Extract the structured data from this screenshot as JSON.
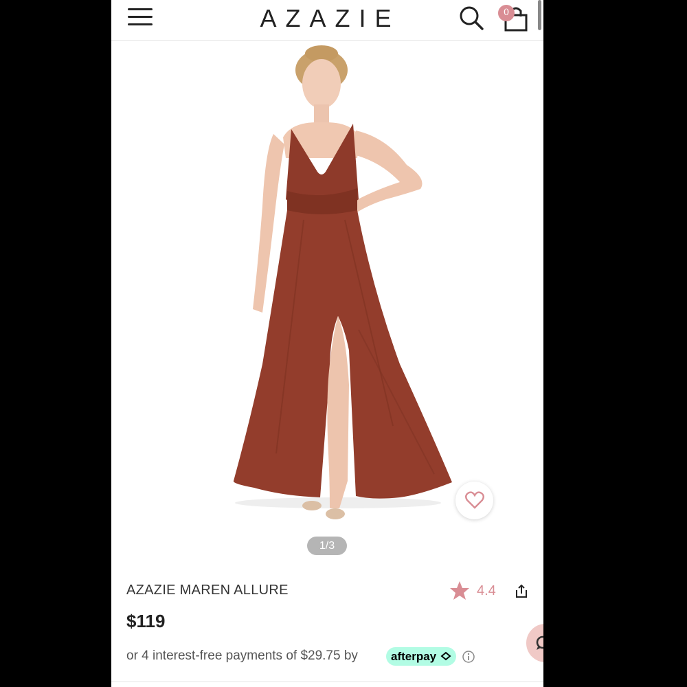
{
  "header": {
    "logo": "AZAZIE",
    "cart_count": "0"
  },
  "gallery": {
    "counter": "1/3"
  },
  "product": {
    "name": "AZAZIE MAREN ALLURE",
    "rating": "4.4",
    "price": "$119",
    "installment_text": "or 4 interest-free payments of $29.75 by",
    "afterpay_label": "afterpay"
  },
  "colors": {
    "dress": "#923c2c",
    "accent_pink": "#d98d94",
    "afterpay_mint": "#b2fce4"
  },
  "icons": [
    "hamburger-menu-icon",
    "search-icon",
    "shopping-bag-icon",
    "heart-icon",
    "star-icon",
    "share-icon",
    "info-icon",
    "chat-icon"
  ]
}
